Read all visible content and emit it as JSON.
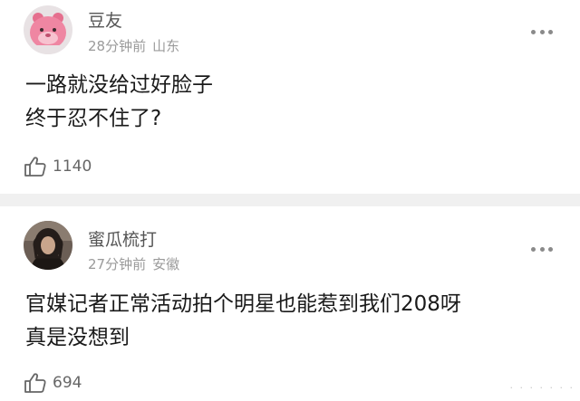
{
  "comments": [
    {
      "username": "豆友",
      "time": "28分钟前",
      "location": "山东",
      "avatar_icon": "pink-cartoon-avatar",
      "lines": [
        "一路就没给过好脸子",
        "终于忍不住了?"
      ],
      "likes": "1140"
    },
    {
      "username": "蜜瓜梳打",
      "time": "27分钟前",
      "location": "安徽",
      "avatar_icon": "dark-photo-avatar",
      "lines": [
        "官媒记者正常活动拍个明星也能惹到我们208呀",
        "真是没想到"
      ],
      "likes": "694"
    }
  ],
  "colors": {
    "divider": "#f0f0f0",
    "meta_text": "#9a9a9a",
    "username": "#555555"
  }
}
